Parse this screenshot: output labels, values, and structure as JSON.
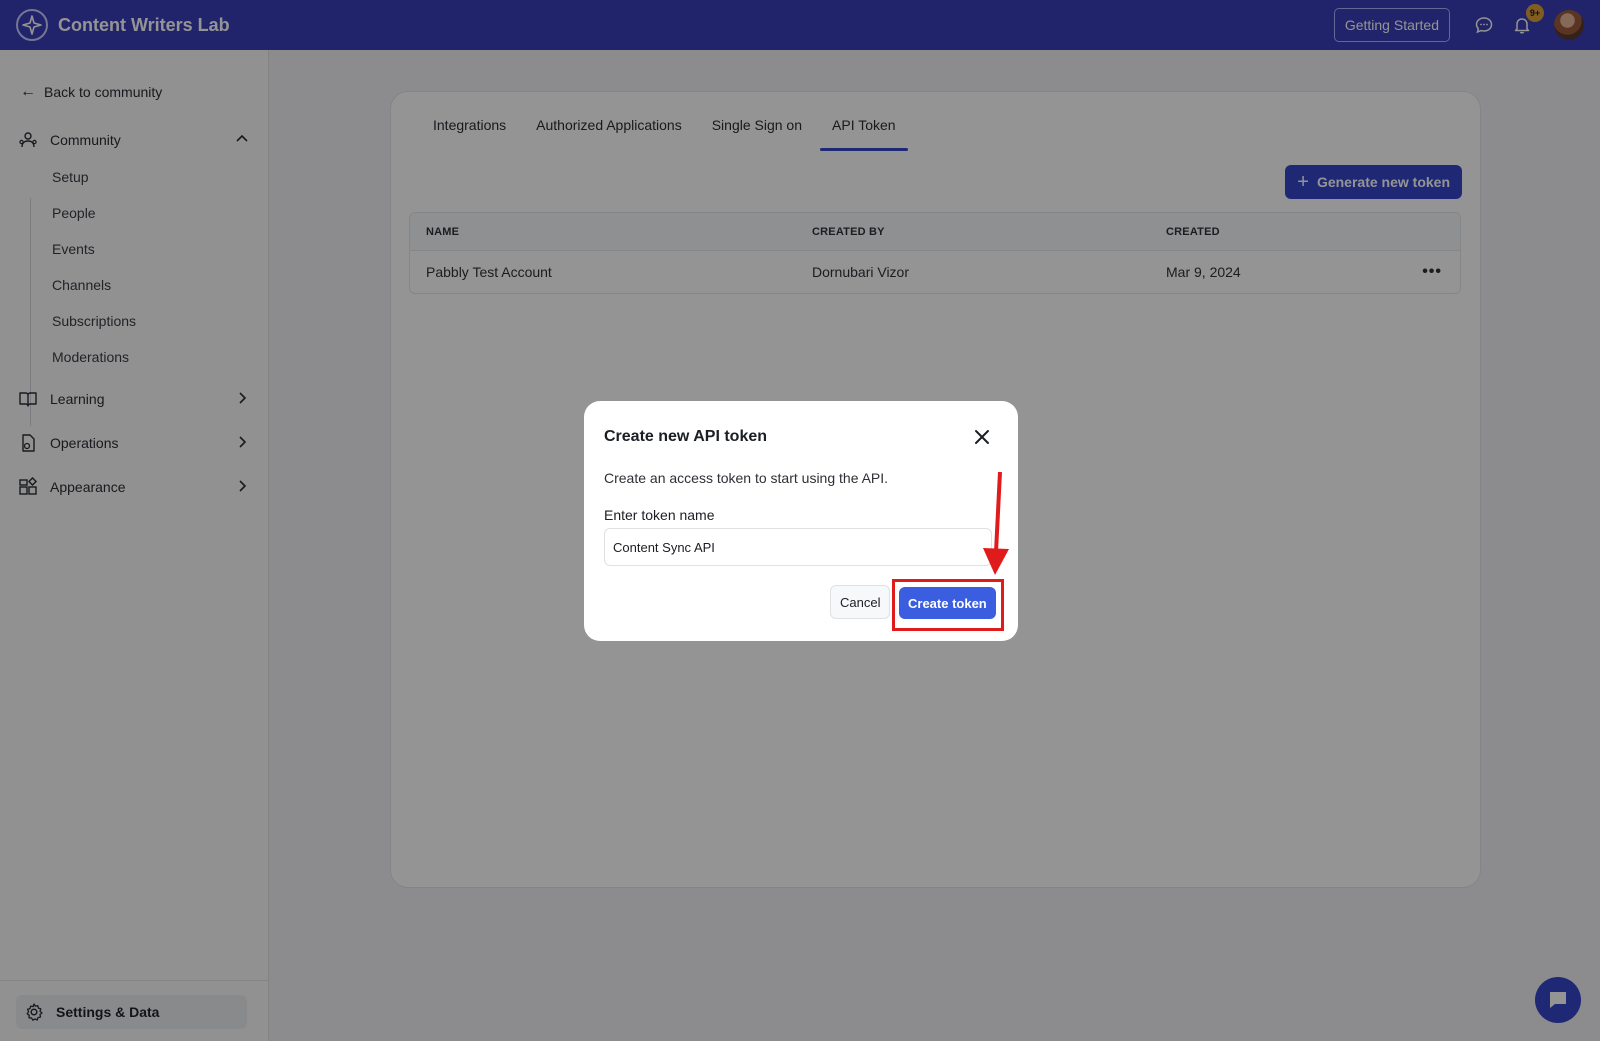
{
  "app": {
    "title": "Content Writers Lab",
    "getting_started": "Getting Started",
    "notif_count": "9+"
  },
  "sidebar": {
    "back_label": "Back to community",
    "community_label": "Community",
    "community_items": [
      "Setup",
      "People",
      "Events",
      "Channels",
      "Subscriptions",
      "Moderations"
    ],
    "learning_label": "Learning",
    "operations_label": "Operations",
    "appearance_label": "Appearance",
    "settings_label": "Settings & Data"
  },
  "main": {
    "tabs": [
      "Integrations",
      "Authorized Applications",
      "Single Sign on",
      "API Token"
    ],
    "active_tab": "API Token",
    "generate_label": "Generate new token",
    "table": {
      "headers": [
        "NAME",
        "CREATED BY",
        "CREATED"
      ],
      "rows": [
        {
          "name": "Pabbly Test Account",
          "created_by": "Dornubari Vizor",
          "created": "Mar 9, 2024",
          "menu": "•••"
        }
      ]
    }
  },
  "modal": {
    "title": "Create new API token",
    "description": "Create an access token to start using the API.",
    "field_label": "Enter token name",
    "field_value": "Content Sync API",
    "cancel_label": "Cancel",
    "create_label": "Create token"
  },
  "colors": {
    "brand": "#3a3db8",
    "primary": "#3546c9",
    "annotation": "#e01b1b"
  }
}
